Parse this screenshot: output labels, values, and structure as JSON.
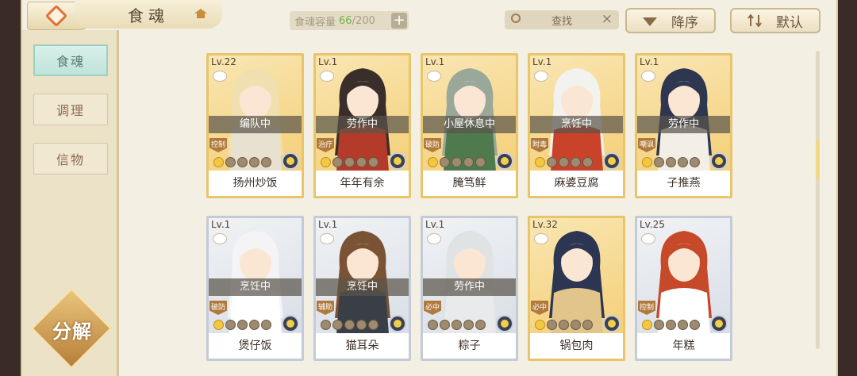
{
  "header": {
    "title": "食魂",
    "capacity_label": "食魂容量",
    "capacity_current": "66",
    "capacity_max": "/200",
    "capacity_plus": "+",
    "search_placeholder": "查找",
    "search_clear": "×",
    "sort_order_label": "降序",
    "sort_mode_label": "默认"
  },
  "sidebar": {
    "items": [
      {
        "label": "食魂",
        "active": true
      },
      {
        "label": "调理",
        "active": false
      },
      {
        "label": "信物",
        "active": false
      }
    ],
    "split_label": "分解"
  },
  "cards": [
    {
      "level": "Lv.22",
      "status": "编队中",
      "role": "控制",
      "stars": 1,
      "name": "扬州炒饭",
      "frame": "gold"
    },
    {
      "level": "Lv.1",
      "status": "劳作中",
      "role": "治疗",
      "stars": 1,
      "name": "年年有余",
      "frame": "gold"
    },
    {
      "level": "Lv.1",
      "status": "小屋休息中",
      "role": "破防",
      "stars": 1,
      "name": "腌笃鲜",
      "frame": "gold"
    },
    {
      "level": "Lv.1",
      "status": "烹饪中",
      "role": "附毒",
      "stars": 1,
      "name": "麻婆豆腐",
      "frame": "gold"
    },
    {
      "level": "Lv.1",
      "status": "劳作中",
      "role": "嘲讽",
      "stars": 1,
      "name": "子推燕",
      "frame": "gold"
    },
    {
      "level": "Lv.1",
      "status": "烹饪中",
      "role": "破防",
      "stars": 1,
      "name": "煲仔饭",
      "frame": "silver"
    },
    {
      "level": "Lv.1",
      "status": "烹饪中",
      "role": "辅助",
      "stars": 0,
      "name": "猫耳朵",
      "frame": "silver"
    },
    {
      "level": "Lv.1",
      "status": "劳作中",
      "role": "必中",
      "stars": 0,
      "name": "粽子",
      "frame": "silver"
    },
    {
      "level": "Lv.32",
      "status": "",
      "role": "必中",
      "stars": 1,
      "name": "锅包肉",
      "frame": "gold"
    },
    {
      "level": "Lv.25",
      "status": "",
      "role": "控制",
      "stars": 1,
      "name": "年糕",
      "frame": "silver"
    }
  ],
  "colors": {
    "gold_frame": "#e8c56b",
    "silver_frame": "#c4cbd8",
    "active_tab": "#bfe3da",
    "capacity_current": "#74b24a"
  }
}
